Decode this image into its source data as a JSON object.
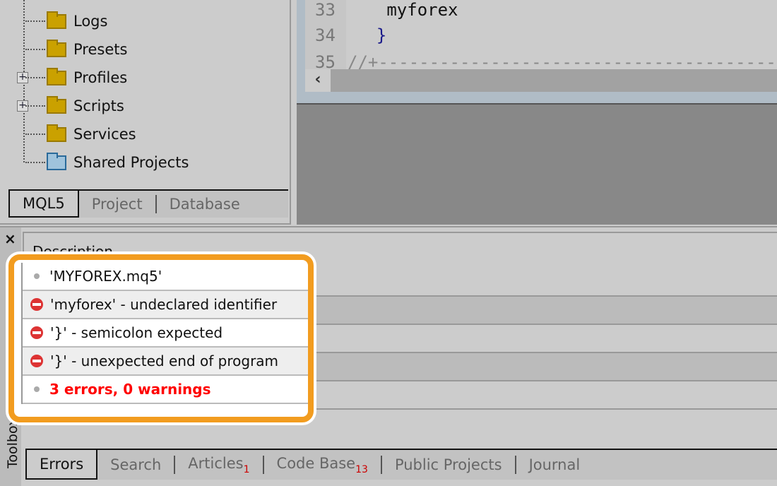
{
  "navigator": {
    "items": [
      {
        "label": "Logs",
        "icon": "folder-icon",
        "expandable": false
      },
      {
        "label": "Presets",
        "icon": "folder-icon",
        "expandable": false
      },
      {
        "label": "Profiles",
        "icon": "folder-icon",
        "expandable": true
      },
      {
        "label": "Scripts",
        "icon": "folder-icon",
        "expandable": true
      },
      {
        "label": "Services",
        "icon": "folder-icon",
        "expandable": false
      },
      {
        "label": "Shared Projects",
        "icon": "shared-folder-icon",
        "expandable": false
      }
    ],
    "tabs": [
      "MQL5",
      "Project",
      "Database"
    ],
    "active_tab": "MQL5"
  },
  "editor": {
    "lines": [
      {
        "num": "33",
        "code": "   myforex"
      },
      {
        "num": "34",
        "code": "  }"
      },
      {
        "num": "35",
        "code": "//+------------------------------------------------"
      }
    ],
    "scroll_left": "‹"
  },
  "toolbox": {
    "title": "Toolbox",
    "close": "×",
    "column_header": "Description",
    "messages": [
      {
        "type": "info",
        "text": "'MYFOREX.mq5'"
      },
      {
        "type": "error",
        "text": "'myforex' - undeclared identifier"
      },
      {
        "type": "error",
        "text": "'}' - semicolon expected"
      },
      {
        "type": "error",
        "text": "'}' - unexpected end of program"
      },
      {
        "type": "summary",
        "text": "3 errors, 0 warnings"
      }
    ],
    "tabs": [
      {
        "label": "Errors",
        "badge": ""
      },
      {
        "label": "Search",
        "badge": ""
      },
      {
        "label": "Articles",
        "badge": "1"
      },
      {
        "label": "Code Base",
        "badge": "13"
      },
      {
        "label": "Public Projects",
        "badge": ""
      },
      {
        "label": "Journal",
        "badge": ""
      }
    ],
    "active_tab": "Errors"
  },
  "colors": {
    "highlight": "#f29c1f",
    "error": "#dd3333",
    "summary_text": "#ff0000",
    "folder": "#caa100"
  }
}
